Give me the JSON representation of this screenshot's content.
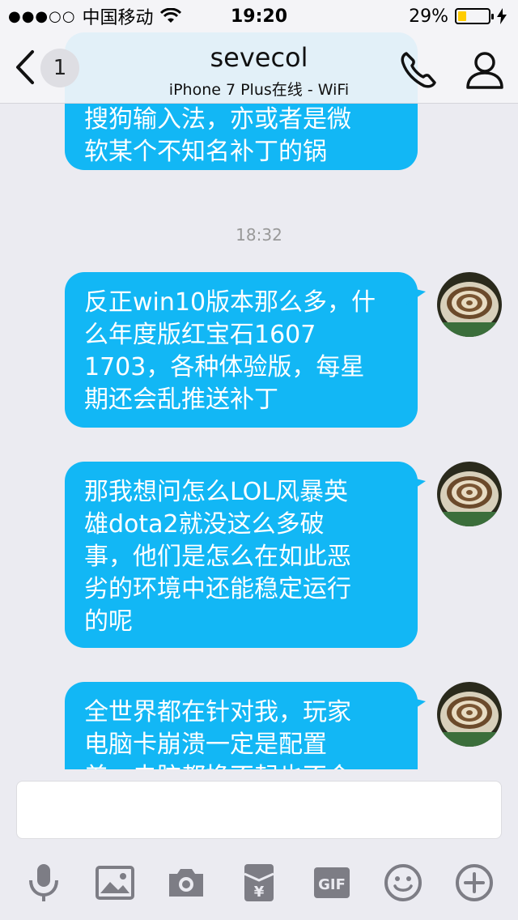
{
  "status_bar": {
    "carrier": "中国移动",
    "time": "19:20",
    "battery_percent": "29%",
    "battery_level": 0.29
  },
  "header": {
    "back_count": "1",
    "title": "sevecol",
    "subtitle": "iPhone 7 Plus在线 - WiFi"
  },
  "messages": {
    "partial_top": "搜狗输入法，亦或者是微\n软某个不知名补丁的锅",
    "timestamp": "18:32",
    "m1": "反正win10版本那么多，什\n么年度版红宝石1607\n1703，各种体验版，每星\n期还会乱推送补丁",
    "m2": "那我想问怎么LOL风暴英\n雄dota2就没这么多破\n事，他们是怎么在如此恶\n劣的环境中还能稳定运行\n的呢",
    "m3": "全世界都在针对我，玩家\n电脑卡崩溃一定是配置\n差，电脑都换不起也不会"
  },
  "colors": {
    "bubble": "#12b7f5",
    "background": "#ebebf1"
  },
  "icons": {
    "toolbar": [
      "microphone-icon",
      "image-icon",
      "camera-icon",
      "red-packet-icon",
      "gif-icon",
      "emoji-icon",
      "plus-icon"
    ],
    "gif_label": "GIF"
  }
}
